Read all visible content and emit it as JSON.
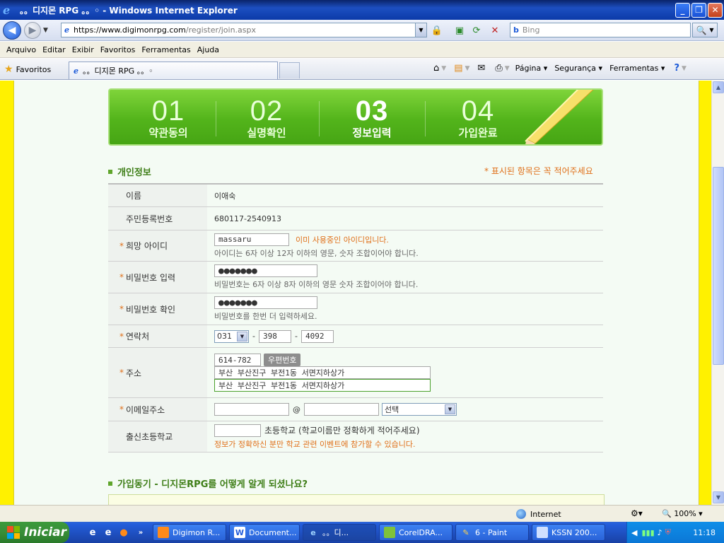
{
  "window": {
    "title": "。。디지몬 RPG 。。◦ - Windows Internet Explorer",
    "minimize": "_",
    "restore": "❐",
    "close": "✕"
  },
  "nav": {
    "address_host": "https://www.digimonrpg.com",
    "address_path": "/register/join.aspx",
    "search_placeholder": "Bing"
  },
  "menu": [
    "Arquivo",
    "Editar",
    "Exibir",
    "Favoritos",
    "Ferramentas",
    "Ajuda"
  ],
  "tabs": {
    "favorites_label": "Favoritos",
    "active_tab": "。。디지몬 RPG 。。◦"
  },
  "commands": {
    "page": "Página",
    "security": "Segurança",
    "tools": "Ferramentas"
  },
  "steps": [
    {
      "num": "01",
      "label": "약관동의"
    },
    {
      "num": "02",
      "label": "실명확인"
    },
    {
      "num": "03",
      "label": "정보입력"
    },
    {
      "num": "04",
      "label": "가입완료"
    }
  ],
  "active_step": 3,
  "section": {
    "title": "개인정보",
    "required_note": "* 표시된 항목은 꼭 적어주세요",
    "motive_title": "가입동기 - 디지몬RPG를 어떻게 알게 되셨나요?"
  },
  "form": {
    "name_label": "이름",
    "name_value": "이애숙",
    "ssn_label": "주민등록번호",
    "ssn_value": "680117-2540913",
    "id_label": "희망 아이디",
    "id_value": "massaru",
    "id_warning": "이미 사용중인 아이디입니다.",
    "id_hint": "아이디는 6자 이상 12자 이하의 영문, 숫자 조합이어야 합니다.",
    "pw_label": "비밀번호 입력",
    "pw_value": "●●●●●●●",
    "pw_hint": "비밀번호는 6자 이상 8자 이하의 영문 숫자 조합이어야 합니다.",
    "pw2_label": "비밀번호 확인",
    "pw2_value": "●●●●●●●",
    "pw2_hint": "비밀번호를 한번 더 입력하세요.",
    "phone_label": "연락처",
    "phone_area": "031",
    "phone_mid": "398",
    "phone_last": "4092",
    "dash": "-",
    "addr_label": "주소",
    "zip": "614-782",
    "zip_button": "우편번호",
    "addr1": "부산 부산진구 부전1동 서면지하상가",
    "addr2": "부산 부산진구 부전1동 서면지하상가",
    "email_label": "이메일주소",
    "email_at": "@",
    "email_select": "선택",
    "school_label": "출신초등학교",
    "school_suffix": "초등학교 (학교이름만 정확하게 적어주세요)",
    "school_note": "정보가 정확하신 분만 학교 관련 이벤트에 참가할 수 있습니다."
  },
  "status": {
    "zone": "Internet",
    "zoom": "100%"
  },
  "taskbar": {
    "start": "Iniciar",
    "tasks": [
      "Digimon R...",
      "Document...",
      "。。디...",
      "CorelDRA...",
      "6 - Paint",
      "KSSN 200..."
    ],
    "clock": "11:18"
  },
  "colors": {
    "step_green": "#53b41b",
    "accent_orange": "#e0701a",
    "side_yellow": "#fff100"
  }
}
